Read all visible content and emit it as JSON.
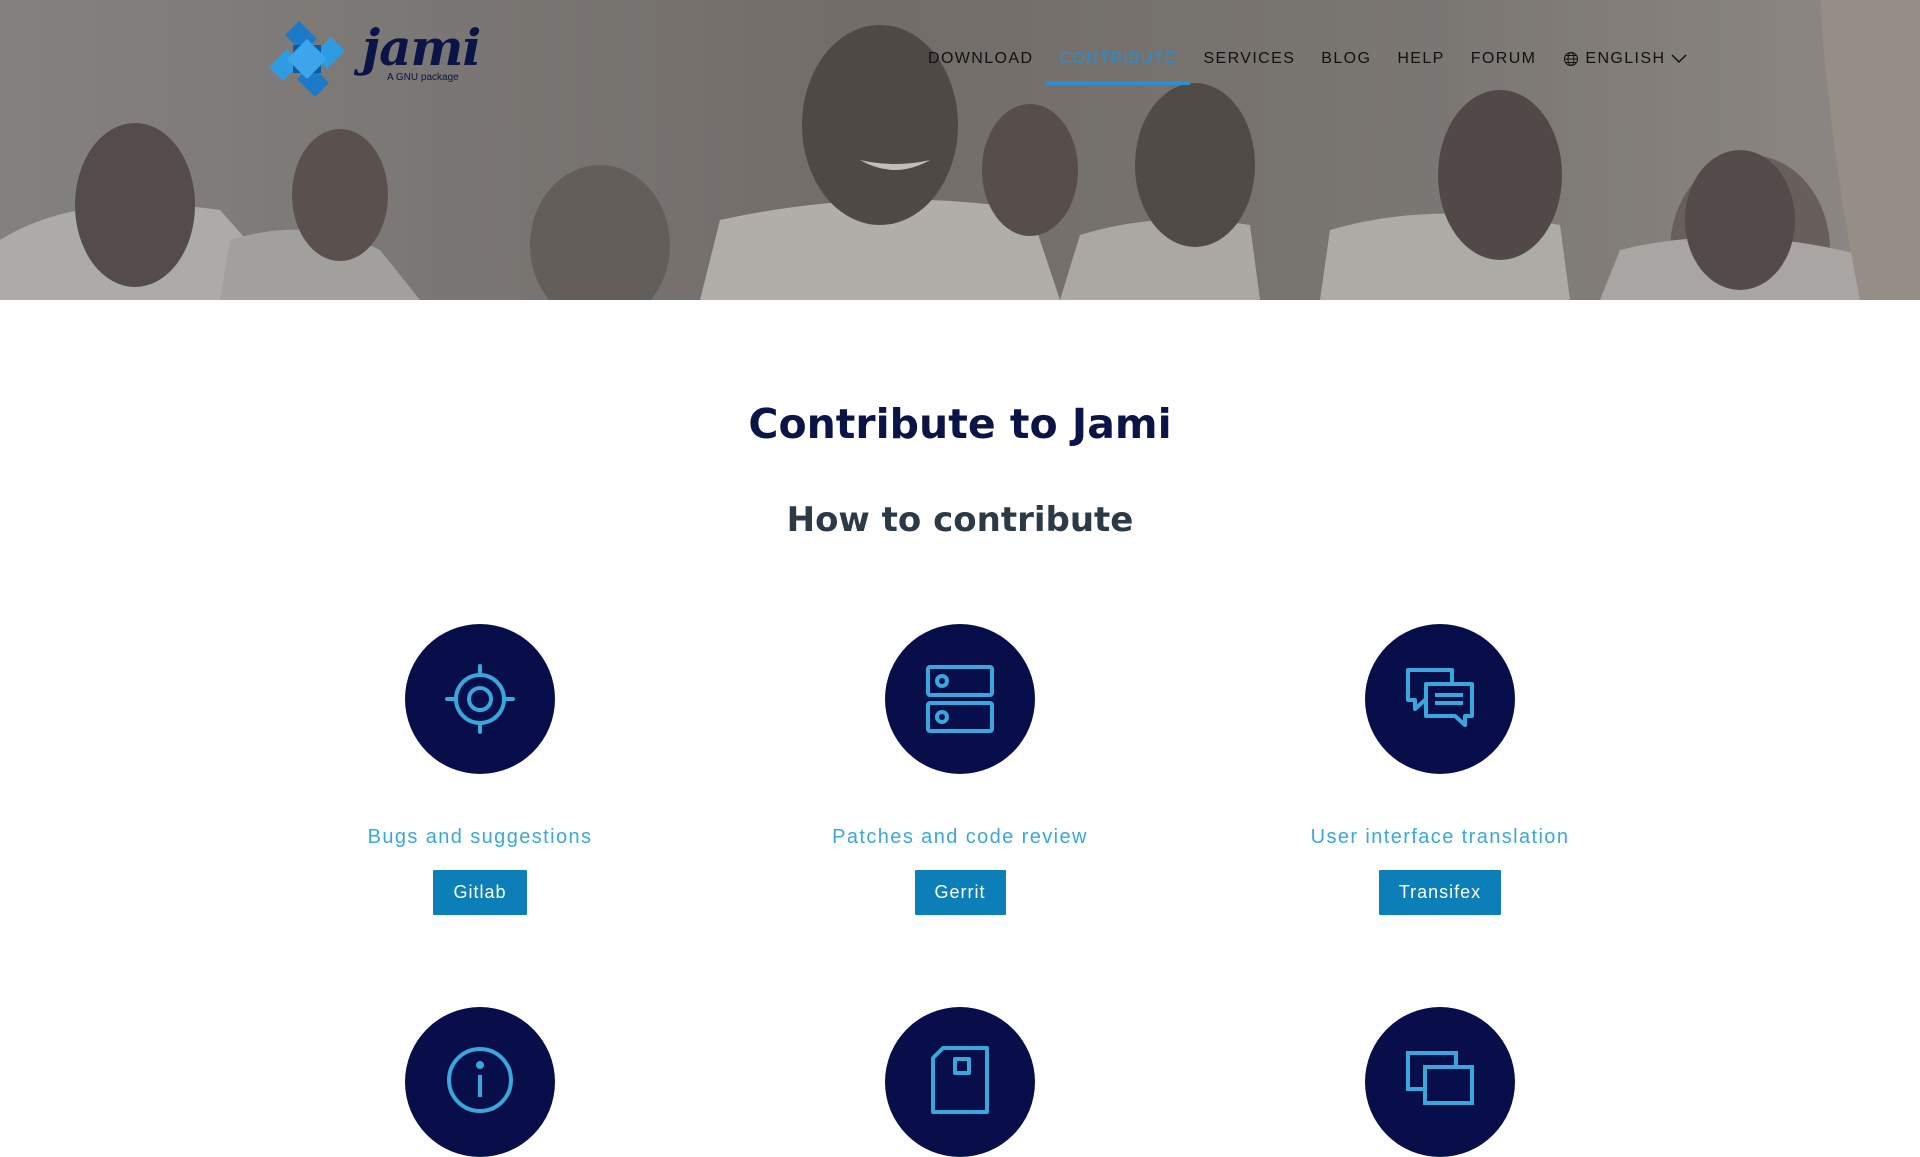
{
  "logo": {
    "word": "jami",
    "tagline": "A GNU package"
  },
  "nav": {
    "items": [
      {
        "label": "DOWNLOAD",
        "active": false
      },
      {
        "label": "CONTRIBUTE",
        "active": true
      },
      {
        "label": "SERVICES",
        "active": false
      },
      {
        "label": "BLOG",
        "active": false
      },
      {
        "label": "HELP",
        "active": false
      },
      {
        "label": "FORUM",
        "active": false
      }
    ],
    "language": "ENGLISH"
  },
  "main": {
    "title": "Contribute to Jami",
    "subtitle": "How to contribute",
    "cards": [
      {
        "icon": "target-icon",
        "title": "Bugs and suggestions",
        "button": "Gitlab"
      },
      {
        "icon": "server-icon",
        "title": "Patches and code review",
        "button": "Gerrit"
      },
      {
        "icon": "chat-icon",
        "title": "User interface translation",
        "button": "Transifex"
      }
    ],
    "more_cards": [
      {
        "icon": "info-icon"
      },
      {
        "icon": "document-icon"
      },
      {
        "icon": "window-icon"
      }
    ]
  },
  "colors": {
    "navy": "#080e4a",
    "accent": "#3aa7dc",
    "button": "#0c7fb8",
    "active_nav": "#2a8fd0"
  }
}
